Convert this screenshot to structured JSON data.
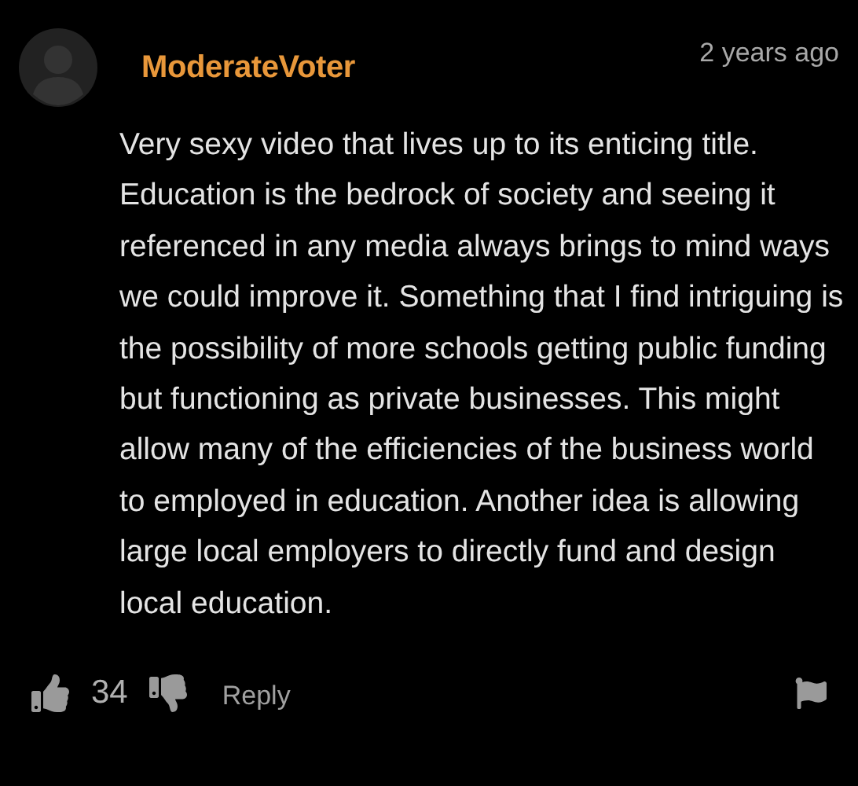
{
  "comment": {
    "author": "ModerateVoter",
    "time": "2 years ago",
    "body": "Very sexy video that lives up to its enticing title. Education is the bedrock of society and seeing it referenced in any media always brings to mind ways we could improve it. Something that I find intriguing is the possibility of more schools getting public funding but functioning as private businesses. This might allow many of the efficiencies of the business world to employed in education. Another idea is allowing large local employers to directly fund and design local education.",
    "likes": "34",
    "reply": "Reply"
  }
}
